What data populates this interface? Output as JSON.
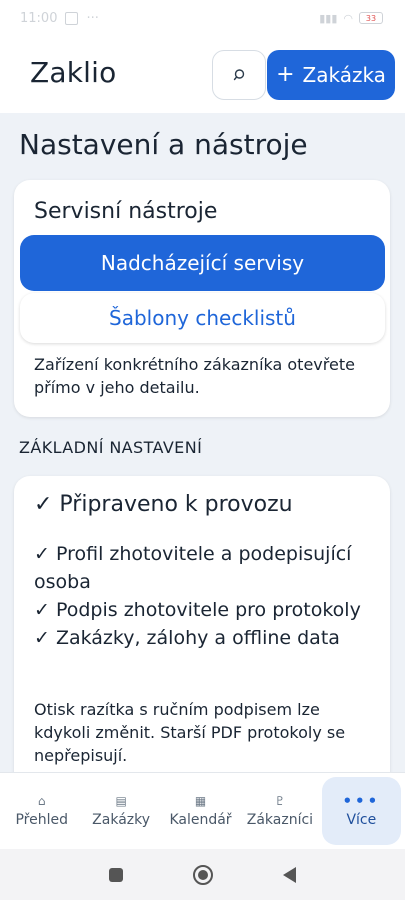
{
  "status_bar": {
    "time": "11:00",
    "dots": "···",
    "battery": "33"
  },
  "header": {
    "logo": "Zaklio",
    "search_icon": "search-icon",
    "add_icon": "plus-icon",
    "add_label": "Zakázka",
    "accent_color": "#1f66d9"
  },
  "page": {
    "title": "Nastavení a nástroje"
  },
  "service_tools": {
    "title": "Servisní nástroje",
    "primary_button": "Nadcházející servisy",
    "secondary_button": "Šablony checklistů",
    "note": "Zařízení konkrétního zákazníka otevřete přímo v jeho detailu."
  },
  "basic_settings": {
    "section_label": "ZÁKLADNÍ NASTAVENÍ",
    "ready_title": "✓ Připraveno k provozu",
    "checklist": [
      "✓  Profil zhotovitele a podepisující osoba",
      "✓  Podpis zhotovitele pro protokoly",
      "✓  Zakázky, zálohy a offline data"
    ],
    "note": "Otisk razítka s ručním podpisem lze kdykoli změnit. Starší PDF protokoly se nepřepisují."
  },
  "bottom_nav": {
    "items": [
      {
        "label": "Přehled",
        "icon": "home-icon",
        "glyph": "⌂"
      },
      {
        "label": "Zakázky",
        "icon": "list-icon",
        "glyph": "▤"
      },
      {
        "label": "Kalendář",
        "icon": "calendar-icon",
        "glyph": "▦"
      },
      {
        "label": "Zákazníci",
        "icon": "person-icon",
        "glyph": "♇"
      },
      {
        "label": "Více",
        "icon": "more-icon",
        "glyph": "•••"
      }
    ],
    "active_index": 4
  }
}
